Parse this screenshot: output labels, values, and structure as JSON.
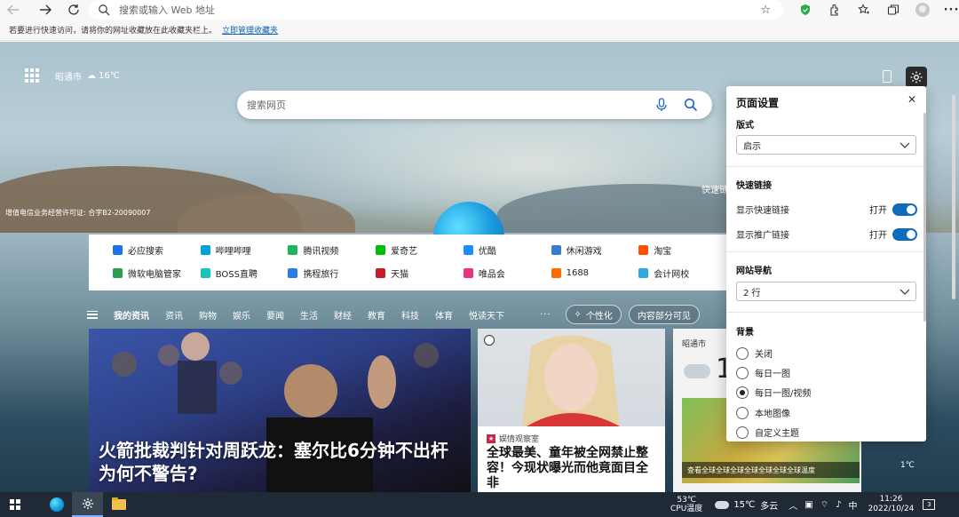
{
  "toolbar": {
    "address_placeholder": "搜索或输入 Web 地址"
  },
  "favbar": {
    "message": "若要进行快速访问，请将你的网址收藏放在此收藏夹栏上。",
    "link": "立即管理收藏夹"
  },
  "header": {
    "city": "昭通市",
    "temp": "16℃"
  },
  "search": {
    "placeholder": "搜索网页"
  },
  "license_text": "增值电信业务经营许可证: 合字B2-20090007",
  "quick_links_hint": "快速链",
  "quick_links": {
    "row1": [
      {
        "label": "必应搜索",
        "color": "#1a73e8",
        "icon": "search-icon"
      },
      {
        "label": "哔哩哔哩",
        "color": "#00a1d6",
        "icon": "tv-icon"
      },
      {
        "label": "腾讯视频",
        "color": "#20b35b",
        "icon": "play-icon"
      },
      {
        "label": "爱奇艺",
        "color": "#00be06",
        "icon": "iqiyi-icon"
      },
      {
        "label": "优酷",
        "color": "#1a8cff",
        "icon": "youku-icon"
      },
      {
        "label": "休闲游戏",
        "color": "#3a7bd5",
        "icon": "game-icon"
      },
      {
        "label": "淘宝",
        "color": "#ff5000",
        "icon": "taobao-icon"
      }
    ],
    "row2": [
      {
        "label": "微软电脑管家",
        "color": "#2b9f4b",
        "icon": "windows-icon"
      },
      {
        "label": "BOSS直聘",
        "color": "#19c3bc",
        "icon": "boss-icon"
      },
      {
        "label": "携程旅行",
        "color": "#2a7de1",
        "icon": "ctrip-icon"
      },
      {
        "label": "天猫",
        "color": "#cc1a2b",
        "icon": "tmall-icon"
      },
      {
        "label": "唯品会",
        "color": "#e7347f",
        "icon": "vip-icon"
      },
      {
        "label": "1688",
        "color": "#ff6a00",
        "icon": "1688-icon"
      },
      {
        "label": "会计网校",
        "color": "#2ea9df",
        "icon": "school-icon"
      }
    ]
  },
  "news_nav": {
    "items": [
      "我的资讯",
      "资讯",
      "购物",
      "娱乐",
      "要闻",
      "生活",
      "财经",
      "教育",
      "科技",
      "体育",
      "悦读天下"
    ],
    "personalize": "个性化",
    "content_visible": "内容部分可见"
  },
  "cards": {
    "main_headline": "火箭批裁判针对周跃龙：塞尔比6分钟不出杆为何不警告?",
    "mid_source": "娱情观察室",
    "mid_title": "全球最美、童年被全网禁止整容！今现状曝光而他竟面目全非",
    "weather_city": "昭通市",
    "weather_temp": "1",
    "weather_caption": "查看全球全球全球全球全球全球全球温度",
    "right_temp": "1℃"
  },
  "settings": {
    "title": "页面设置",
    "layout_label": "版式",
    "layout_value": "启示",
    "quick_links_label": "快速链接",
    "show_quick_links": "显示快速链接",
    "show_quick_links_state": "打开",
    "show_promo_links": "显示推广链接",
    "show_promo_links_state": "打开",
    "site_nav_label": "网站导航",
    "site_nav_value": "2 行",
    "background_label": "背景",
    "bg_options": [
      "关闭",
      "每日一图",
      "每日一图/视频",
      "本地图像",
      "自定义主题"
    ],
    "bg_selected_index": 2
  },
  "taskbar": {
    "cpu_temp": "53℃",
    "cpu_label": "CPU温度",
    "weather_temp": "15℃",
    "weather_desc": "多云",
    "ime": "中",
    "time": "11:26",
    "date": "2022/10/24",
    "notify_count": "3"
  }
}
